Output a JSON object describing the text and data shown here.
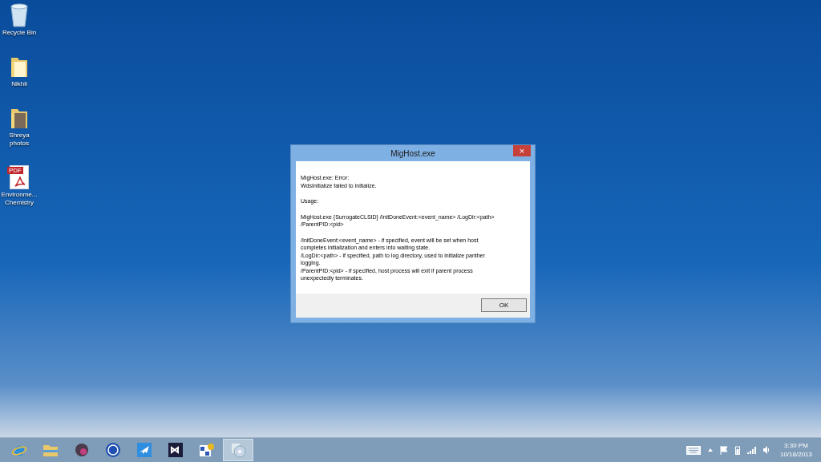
{
  "desktop_icons": [
    {
      "kind": "recycle",
      "label": "Recycle Bin"
    },
    {
      "kind": "folder",
      "label": "Nikhil"
    },
    {
      "kind": "photo-folder",
      "label": "Shreya photos"
    },
    {
      "kind": "pdf",
      "label": "Environme... Chemistry",
      "badge": "PDF"
    }
  ],
  "dialog": {
    "title": "MigHost.exe",
    "close": "×",
    "paragraphs": [
      [
        "MigHost.exe: Error:",
        "WdsInitialize failed to initialize."
      ],
      [
        "Usage:"
      ],
      [
        "MigHost.exe {SurrogateCLSID} /InitDoneEvent:<event_name> /LogDir:<path>",
        "/ParentPID:<pid>"
      ],
      [
        "/InitDoneEvent:<event_name> - if specified, event will be set when host",
        "completes initialization and enters into waiting state.",
        "/LogDir:<path> - if specified, path to log directory, used to initialize panther",
        "logging.",
        "/ParentPID:<pid> - if specified, host process will exit if parent process",
        "unexpectedly terminates."
      ]
    ],
    "buttons": [
      "OK"
    ]
  },
  "taskbar": {
    "apps": [
      {
        "kind": "ie",
        "selected": false
      },
      {
        "kind": "explorer",
        "selected": false
      },
      {
        "kind": "orb",
        "selected": false
      },
      {
        "kind": "globe",
        "selected": false
      },
      {
        "kind": "plane",
        "selected": false
      },
      {
        "kind": "studio",
        "selected": false
      },
      {
        "kind": "paint",
        "selected": false
      },
      {
        "kind": "disc",
        "selected": true
      }
    ],
    "time": "3:30 PM",
    "date": "10/18/2013"
  }
}
